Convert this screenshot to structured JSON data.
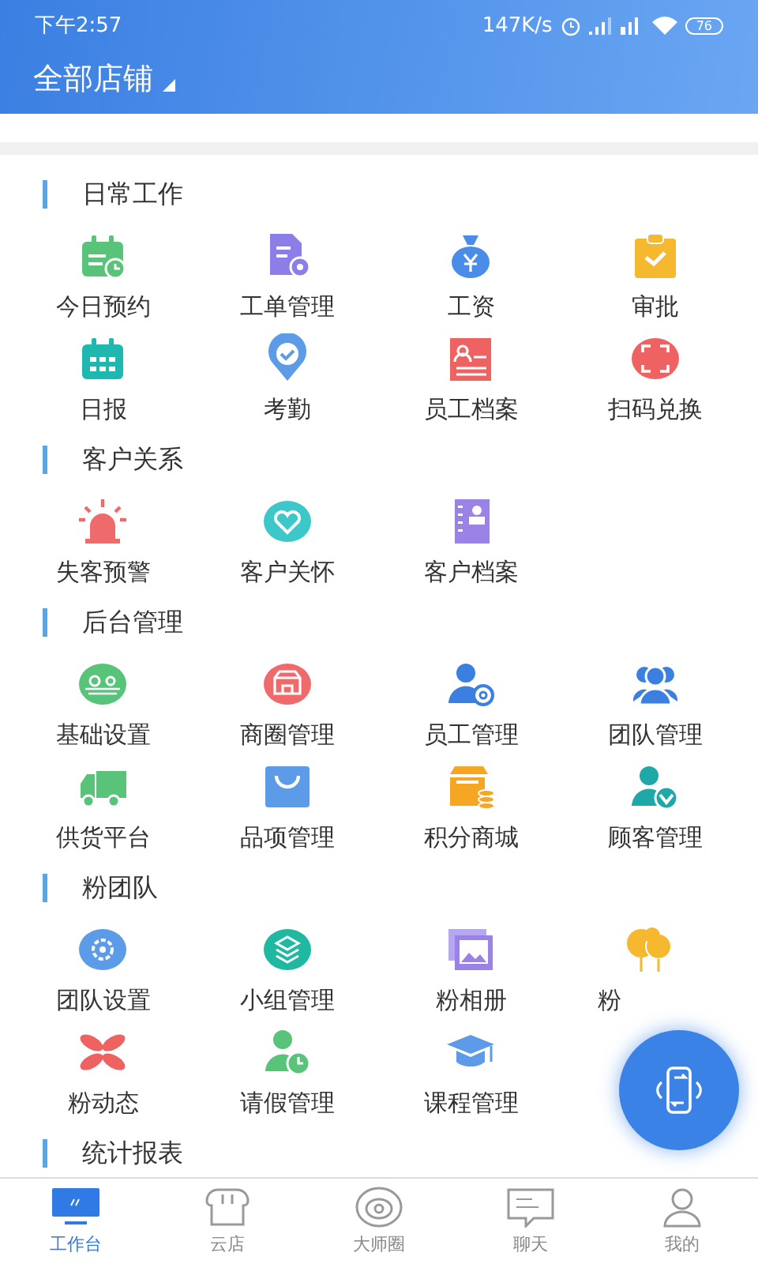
{
  "status_bar": {
    "time": "下午2:57",
    "network_speed": "147K/s",
    "battery": "76"
  },
  "header": {
    "title": "全部店铺"
  },
  "sections": [
    {
      "title": "日常工作",
      "items": [
        {
          "label": "今日预约"
        },
        {
          "label": "工单管理"
        },
        {
          "label": "工资"
        },
        {
          "label": "审批"
        },
        {
          "label": "日报"
        },
        {
          "label": "考勤"
        },
        {
          "label": "员工档案"
        },
        {
          "label": "扫码兑换"
        }
      ]
    },
    {
      "title": "客户关系",
      "items": [
        {
          "label": "失客预警"
        },
        {
          "label": "客户关怀"
        },
        {
          "label": "客户档案"
        }
      ]
    },
    {
      "title": "后台管理",
      "items": [
        {
          "label": "基础设置"
        },
        {
          "label": "商圈管理"
        },
        {
          "label": "员工管理"
        },
        {
          "label": "团队管理"
        },
        {
          "label": "供货平台"
        },
        {
          "label": "品项管理"
        },
        {
          "label": "积分商城"
        },
        {
          "label": "顾客管理"
        }
      ]
    },
    {
      "title": "粉团队",
      "items": [
        {
          "label": "团队设置"
        },
        {
          "label": "小组管理"
        },
        {
          "label": "粉相册"
        },
        {
          "label": "粉",
          "covered": true
        },
        {
          "label": "粉动态"
        },
        {
          "label": "请假管理"
        },
        {
          "label": "课程管理"
        }
      ]
    },
    {
      "title": "统计报表"
    }
  ],
  "bottom_nav": [
    {
      "label": "工作台",
      "selected": true
    },
    {
      "label": "云店",
      "selected": false
    },
    {
      "label": "大师圈",
      "selected": false
    },
    {
      "label": "聊天",
      "selected": false
    },
    {
      "label": "我的",
      "selected": false
    }
  ]
}
